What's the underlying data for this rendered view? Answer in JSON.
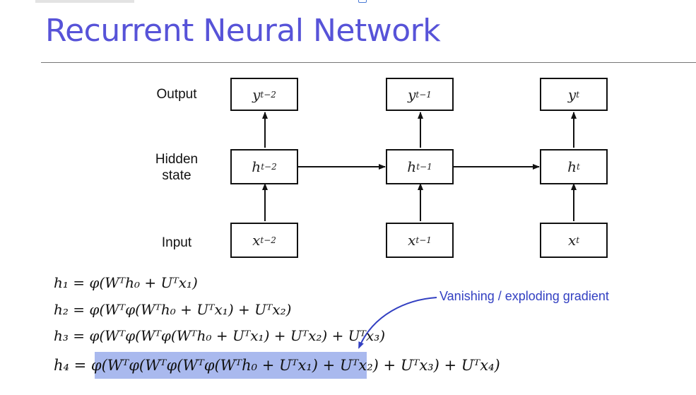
{
  "title": "Recurrent Neural Network",
  "row_labels": {
    "output": "Output",
    "hidden_line1": "Hidden",
    "hidden_line2": "state",
    "input": "Input"
  },
  "nodes": {
    "outputs": [
      "y_{t-2}",
      "y_{t-1}",
      "y_t"
    ],
    "hidden": [
      "h_{t-2}",
      "h_{t-1}",
      "h_t"
    ],
    "inputs": [
      "x_{t-2}",
      "x_{t-1}",
      "x_t"
    ]
  },
  "equations": [
    "h₁ = φ(Wᵀh₀ + Uᵀx₁)",
    "h₂ = φ(Wᵀφ(Wᵀh₀ + Uᵀx₁) + Uᵀx₂)",
    "h₃ = φ(Wᵀφ(Wᵀφ(Wᵀh₀ + Uᵀx₁) + Uᵀx₂) + Uᵀx₃)",
    "h₄ = φ(Wᵀφ(Wᵀφ(Wᵀφ(Wᵀh₀ + Uᵀx₁) + Uᵀx₂) + Uᵀx₃) + Uᵀx₄)"
  ],
  "annotation": "Vanishing / exploding gradient",
  "colors": {
    "title": "#5753d8",
    "annotation": "#3340c2",
    "highlight": "#a9b9ee"
  }
}
